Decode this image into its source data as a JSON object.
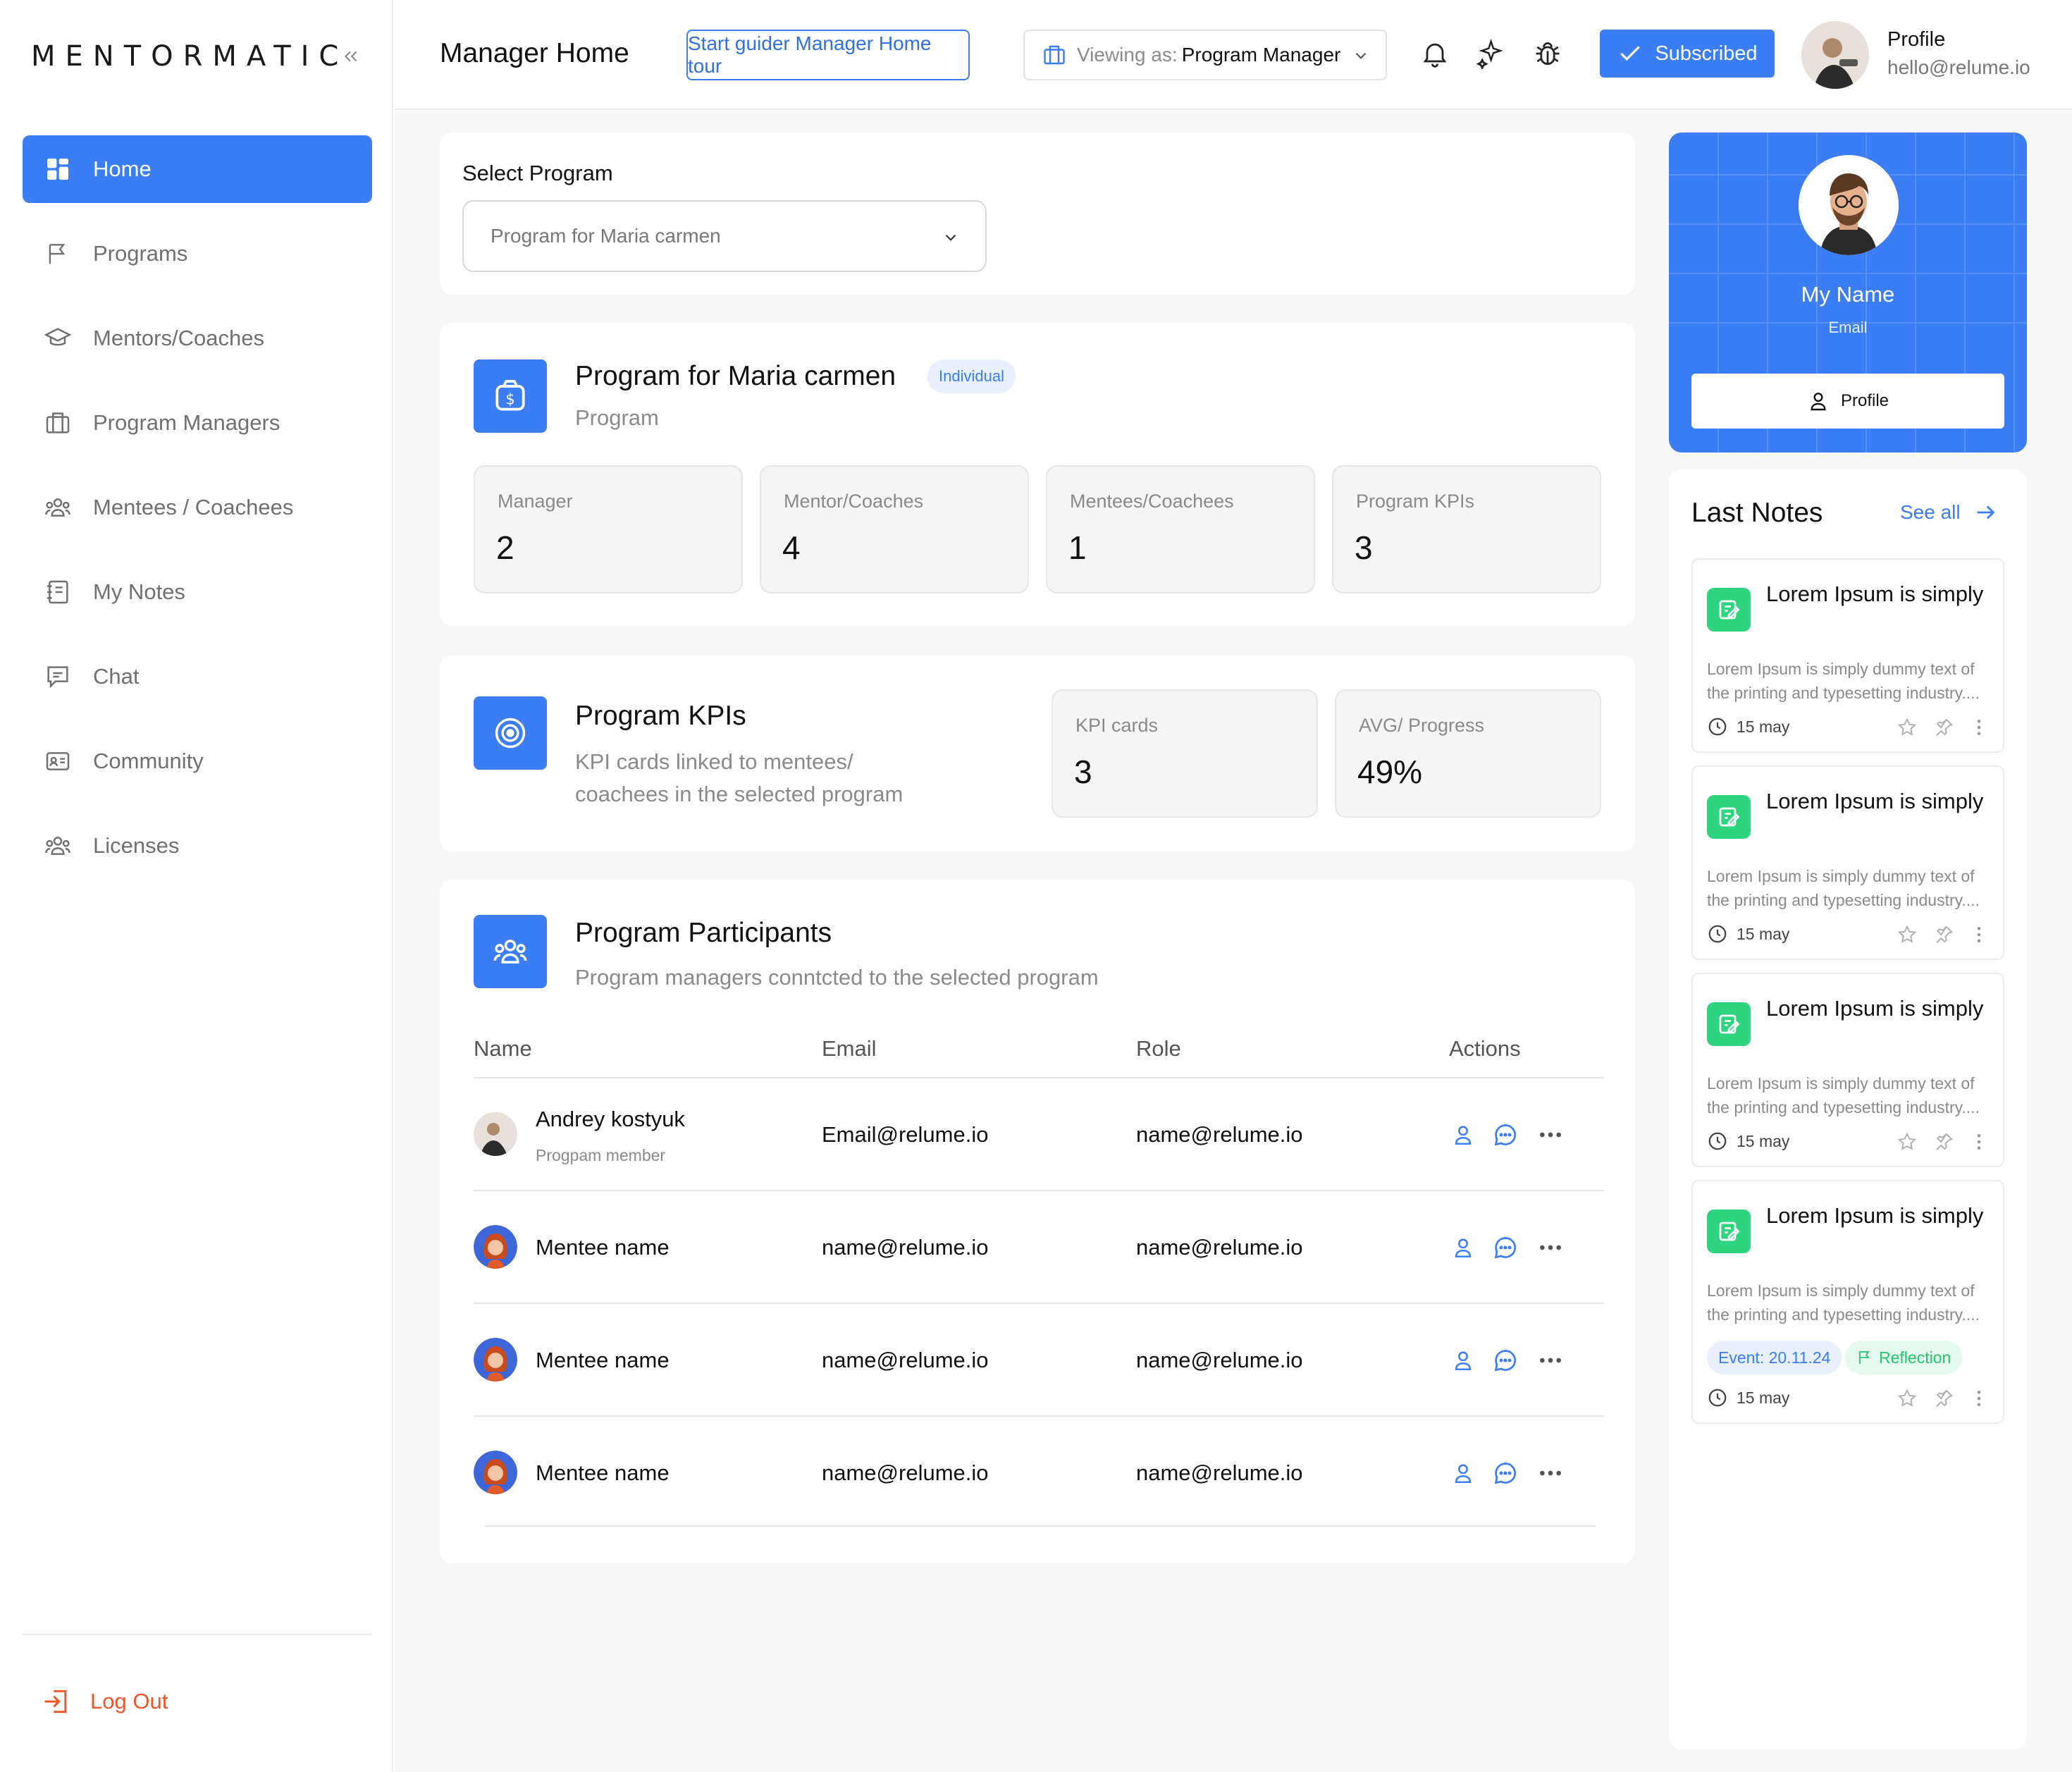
{
  "app": {
    "logo": "MENTORMATIC"
  },
  "sidebar": {
    "items": [
      {
        "label": "Home",
        "icon": "grid-icon",
        "active": true
      },
      {
        "label": "Programs",
        "icon": "flag-icon"
      },
      {
        "label": "Mentors/Coaches",
        "icon": "graduation-cap-icon"
      },
      {
        "label": "Program Managers",
        "icon": "briefcase-icon"
      },
      {
        "label": "Mentees / Coachees",
        "icon": "users-icon"
      },
      {
        "label": "My Notes",
        "icon": "notebook-icon"
      },
      {
        "label": "Chat",
        "icon": "chat-icon"
      },
      {
        "label": "Community",
        "icon": "id-card-icon"
      },
      {
        "label": "Licenses",
        "icon": "users-icon"
      }
    ],
    "logout_label": "Log Out"
  },
  "header": {
    "title": "Manager Home",
    "tour_label": "Start guider Manager Home tour",
    "viewing_label": "Viewing as:",
    "viewing_value": "Program Manager",
    "subscribed_label": "Subscribed",
    "profile_name": "Profile",
    "profile_email": "hello@relume.io"
  },
  "select_program": {
    "label": "Select Program",
    "value": "Program for Maria carmen"
  },
  "program": {
    "title": "Program for Maria carmen",
    "badge": "Individual",
    "subtitle": "Program",
    "stats": [
      {
        "label": "Manager",
        "value": "2"
      },
      {
        "label": "Mentor/Coaches",
        "value": "4"
      },
      {
        "label": "Mentees/Coachees",
        "value": "1"
      },
      {
        "label": "Program KPIs",
        "value": "3"
      }
    ]
  },
  "kpis": {
    "title": "Program KPIs",
    "subtitle_line1": "KPI cards linked to mentees/",
    "subtitle_line2": "coachees in the selected program",
    "stats": [
      {
        "label": "KPI cards",
        "value": "3"
      },
      {
        "label": "AVG/ Progress",
        "value": "49%"
      }
    ]
  },
  "participants": {
    "title": "Program Participants",
    "subtitle": "Program managers conntcted to the selected program",
    "columns": [
      "Name",
      "Email",
      "Role",
      "Actions"
    ],
    "rows": [
      {
        "name": "Andrey kostyuk",
        "subname": "Progpam member",
        "email": "Email@relume.io",
        "role": "name@relume.io"
      },
      {
        "name": "Mentee name",
        "email": "name@relume.io",
        "role": "name@relume.io"
      },
      {
        "name": "Mentee name",
        "email": "name@relume.io",
        "role": "name@relume.io"
      },
      {
        "name": "Mentee name",
        "email": "name@relume.io",
        "role": "name@relume.io"
      }
    ]
  },
  "profile_card": {
    "name": "My Name",
    "email": "Email",
    "button_label": "Profile"
  },
  "notes": {
    "title": "Last Notes",
    "see_all": "See all",
    "items": [
      {
        "title": "Lorem Ipsum is simply",
        "body": "Lorem Ipsum is simply dummy text of the printing and typesetting industry....",
        "date": "15 may"
      },
      {
        "title": "Lorem Ipsum is simply",
        "body": "Lorem Ipsum is simply dummy text of the printing and typesetting industry....",
        "date": "15 may"
      },
      {
        "title": "Lorem Ipsum is simply",
        "body": "Lorem Ipsum is simply dummy text of the printing and typesetting industry....",
        "date": "15 may"
      },
      {
        "title": "Lorem Ipsum is simply",
        "body": "Lorem Ipsum is simply dummy text of the printing and typesetting industry....",
        "date": "15 may",
        "tag_event": "Event: 20.11.24",
        "tag_reflection": "Reflection"
      }
    ]
  },
  "colors": {
    "accent": "#3b7df5",
    "note_icon": "#2ed57f",
    "logout": "#f0552a"
  }
}
